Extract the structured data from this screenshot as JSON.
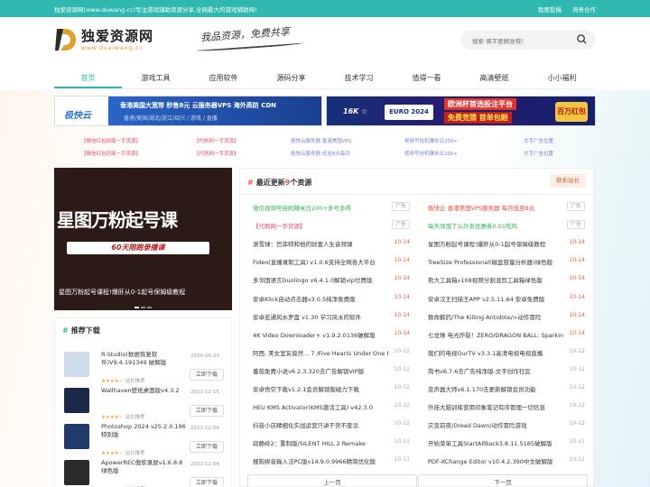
{
  "topbar": {
    "welcome": "独爱资源网(www.duwang.cc)专注游戏辅助资源分享,全网最大的游戏辅助网!",
    "links": [
      "我要投稿",
      "商务合作"
    ]
  },
  "header": {
    "logo_cn": "独爱资源网",
    "logo_en": "www.duaiwang.cc",
    "slogan": "我品资源，免费共享",
    "search_placeholder": "搜索 俩字更精准哦！"
  },
  "nav": [
    {
      "label": "首页",
      "active": true
    },
    {
      "label": "游戏工具",
      "active": false
    },
    {
      "label": "应用软件",
      "active": false
    },
    {
      "label": "源码分享",
      "active": false
    },
    {
      "label": "技术学习",
      "active": false
    },
    {
      "label": "值得一看",
      "active": false
    },
    {
      "label": "高清壁纸",
      "active": false
    },
    {
      "label": "小小福利",
      "active": false
    }
  ],
  "banner1": {
    "logo": "极快云",
    "line1": "香港美国大宽带  秒售8元  云服务器VPS  海外高防 CDN",
    "line2": "香港/美国/湖北/浙江/绍兴  / 游戏 / 直播"
  },
  "banner2": {
    "pre": "16K ☆",
    "euro": "EURO 2024",
    "red1": "欧洲杯首选投注平台",
    "red2": "免费竞猜 首单包赔",
    "prize": "百万红包"
  },
  "text_ads": [
    {
      "text": "【微信红包封面一手货源】",
      "color": "#e64a6b"
    },
    {
      "text": "【代刷网一手货源】",
      "color": "#e64a6b"
    },
    {
      "text": "极快云服务器 香港美国VPS",
      "color": "#7a7fd0"
    },
    {
      "text": "视频号挂机赚米日200+",
      "color": "#7a7fd0"
    },
    {
      "text": "文字广告位置",
      "color": "#7a7fd0"
    },
    {
      "text": "【微信红包封面一手货源】",
      "color": "#e64a6b"
    },
    {
      "text": "【代刷网一手货源】",
      "color": "#e64a6b"
    },
    {
      "text": "极快云服务器 低至8元每月",
      "color": "#7a7fd0"
    },
    {
      "text": "视频号挂机赚米日200+",
      "color": "#7a7fd0"
    },
    {
      "text": "文字广告位置",
      "color": "#7a7fd0"
    }
  ],
  "featured": {
    "big": "星图万粉起号课",
    "sub": "60天陪跑录播课",
    "caption": "星图万粉起号课程!爆肝从0-1起号保姆级教程"
  },
  "recommend": {
    "title": "推荐下载",
    "items": [
      {
        "title": "R-Studio(数据恢复软件)V9.4.191349 破解版",
        "date": "2024-06-23",
        "stars": "★★★★☆",
        "tag": "站长推荐",
        "btn": "立即下载"
      },
      {
        "title": "Wallhaven壁纸桌面版v4.3.2",
        "date": "2023-12-15",
        "stars": "★★★★☆",
        "tag": "站长推荐",
        "btn": "立即下载"
      },
      {
        "title": "Photoshop 2024 v25.2.0.196特别版",
        "date": "2023-12-06",
        "stars": "★★★★☆",
        "tag": "站长推荐",
        "btn": "立即下载"
      },
      {
        "title": "ApowerREC傲软录屏v1.6.8.8绿色版",
        "date": "2023-12-06",
        "stars": "★★★★☆",
        "tag": "站长推荐",
        "btn": "立即下载"
      }
    ]
  },
  "latest": {
    "title": "最近更新",
    "count": "9",
    "title_suffix": "个资源",
    "contact": "联系站长",
    "left": [
      {
        "title": "微信视频号挂机赚米日200+多号多得",
        "tag": "广告",
        "color": "#2fae57"
      },
      {
        "title": "【代刷网一手货源】",
        "tag": "广告",
        "color": "#e64a6b"
      },
      {
        "title": "滚雪球：巴菲特和他的财富人生音频课",
        "date": "10-14"
      },
      {
        "title": "Fideo(直播录制工具) v1.0.6支持全网各大平台",
        "date": "10-14"
      },
      {
        "title": "多邻国语言Duolingo v6.4.1.0解锁vip付费版",
        "date": "10-14"
      },
      {
        "title": "安卓Klick自动点击器v3.0.5纯净免费版",
        "date": "10-14"
      },
      {
        "title": "安卓宏通风水罗盘 v1.30 学习风水的软件",
        "date": "10-14"
      },
      {
        "title": "4K Video Downloader+ v1.9.2.0136破解版",
        "date": "10-14"
      },
      {
        "title": "阿西, 美女室友竟然... 7 /Five Hearts Under One Roof",
        "date": "10-12",
        "grey": true
      },
      {
        "title": "番茄免费小说v6.2.3.320去广告解锁VIP版",
        "date": "10-12",
        "grey": true
      },
      {
        "title": "安卓悟空下载v1.2.1会员解锁版磁力下载",
        "date": "10-12",
        "grey": true
      },
      {
        "title": "HEU KMS Activator(KMS激活工具) v42.3.0",
        "date": "10-12",
        "grey": true
      },
      {
        "title": "抖音小店精细化实战运营只讲干货不废话",
        "date": "10-12",
        "grey": true
      },
      {
        "title": "寂静岭2：重制版/SILENT HILL 2 Remake",
        "date": "10-11",
        "grey": true
      },
      {
        "title": "搜狗拼音输入法PC版v14.9.0.9966精简优化版",
        "date": "10-11",
        "grey": true
      }
    ],
    "right": [
      {
        "title": "极快云 香港美国VPS服务器 每月低至8元",
        "tag": "广告",
        "color": "#e64a3a"
      },
      {
        "title": "每天领饿了么外卖优惠券0.01吃鸡",
        "tag": "广告",
        "color": "#2fae57"
      },
      {
        "title": "星图万粉起号课程!爆肝从0-1起号保姆级教程",
        "date": "10-14"
      },
      {
        "title": "TreeSize Professional(磁盘容量分析器)绿色版",
        "date": "10-14"
      },
      {
        "title": "熊大工具箱v108视频分割混剪工具箱绿色版",
        "date": "10-14"
      },
      {
        "title": "安卓汉王扫描王APP v2.5.11.64 安卓免费版",
        "date": "10-14"
      },
      {
        "title": "致命解药/The Killing Antidote/>动作冒险",
        "date": "10-14"
      },
      {
        "title": "七龙珠 电光炸裂！ZERO/DRAGON BALL: Sparking ZERO",
        "date": "10-14"
      },
      {
        "title": "我们的电视OurTV v3.3.1高清电视电视直播",
        "date": "10-12",
        "grey": true
      },
      {
        "title": "简书v6.7.6去广告纯净版-文字创作社区",
        "date": "10-12",
        "grey": true
      },
      {
        "title": "变声器大师v6.1.170去更新解锁会员功能",
        "date": "10-12",
        "grey": true
      },
      {
        "title": "外挂大脑训练营用印象笔记有序管理一切信息",
        "date": "10-12",
        "grey": true
      },
      {
        "title": "灾变前夜/Dread Dawn/动作冒险游戏",
        "date": "10-12",
        "grey": true
      },
      {
        "title": "开始菜单工具StartAllBack3.8.11.5185破解版",
        "date": "10-11",
        "grey": true
      },
      {
        "title": "PDF-XChange Editor v10.4.2.390中文破解版",
        "date": "10-11",
        "grey": true
      }
    ],
    "prev": "上一页",
    "next": "下一页"
  },
  "colors": {
    "accent": "#2fb8af",
    "date": "#ec5a3a"
  }
}
